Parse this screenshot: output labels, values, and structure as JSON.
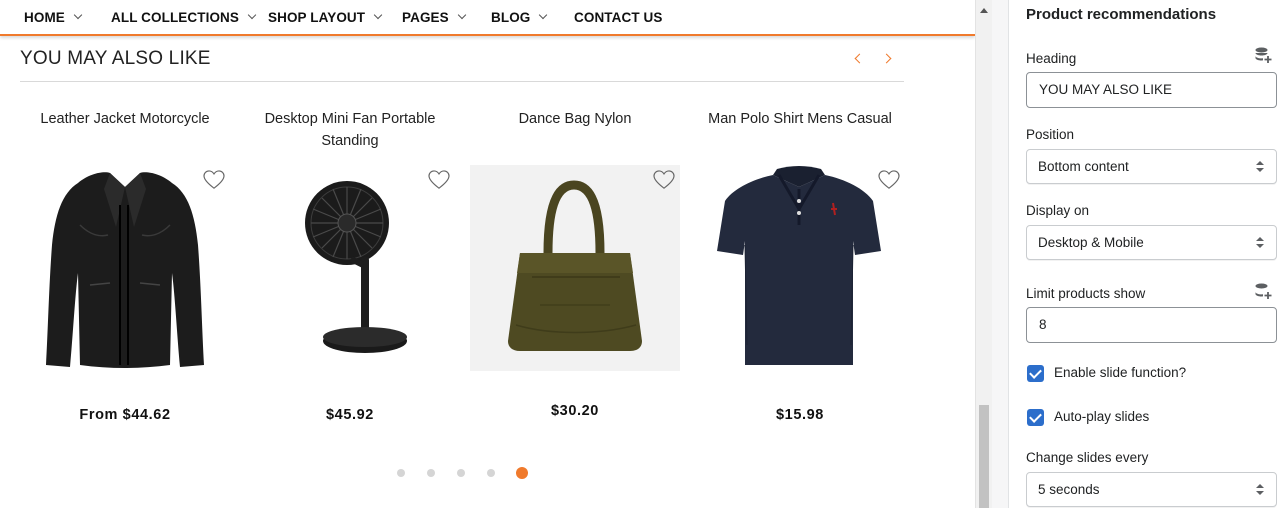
{
  "nav": {
    "items": [
      {
        "label": "HOME"
      },
      {
        "label": "ALL COLLECTIONS"
      },
      {
        "label": "SHOP LAYOUT"
      },
      {
        "label": "PAGES"
      },
      {
        "label": "BLOG"
      },
      {
        "label": "CONTACT US"
      }
    ]
  },
  "section": {
    "title": "YOU MAY ALSO LIKE"
  },
  "products": [
    {
      "name": "Leather Jacket Motorcycle",
      "price": "From $44.62",
      "icon": "leather-jacket-image"
    },
    {
      "name": "Desktop Mini Fan Portable Standing",
      "price": "$45.92",
      "icon": "desk-fan-image"
    },
    {
      "name": "Dance Bag Nylon",
      "price": "$30.20",
      "icon": "tote-bag-image"
    },
    {
      "name": "Man Polo Shirt Mens Casual",
      "price": "$15.98",
      "icon": "polo-shirt-image"
    }
  ],
  "carousel": {
    "dot_count": 5,
    "active_dot": 5
  },
  "colors": {
    "accent": "#f07a2c",
    "checkbox": "#2c6ecb"
  },
  "panel": {
    "title": "Product recommendations",
    "heading_label": "Heading",
    "heading_value": "YOU MAY ALSO LIKE",
    "position_label": "Position",
    "position_value": "Bottom content",
    "display_label": "Display on",
    "display_value": "Desktop & Mobile",
    "limit_label": "Limit products show",
    "limit_value": "8",
    "slide_label": "Enable slide function?",
    "slide_checked": true,
    "autoplay_label": "Auto-play slides",
    "autoplay_checked": true,
    "interval_label": "Change slides every",
    "interval_value": "5 seconds"
  }
}
